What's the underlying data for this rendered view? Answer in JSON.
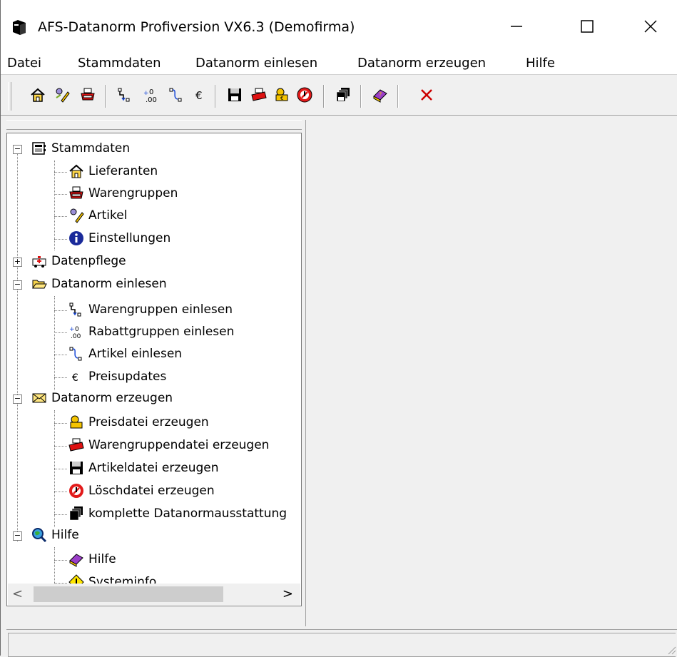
{
  "window": {
    "title": "AFS-Datanorm Profiversion VX6.3 (Demofirma)"
  },
  "menu": [
    "Datei",
    "Stammdaten",
    "Datanorm einlesen",
    "Datanorm erzeugen",
    "Hilfe"
  ],
  "toolbar": {
    "buttons": [
      "home-icon",
      "edit-icon",
      "printer-icon",
      "import-groups-icon",
      "import-discount-icon",
      "import-articles-icon",
      "euro-icon",
      "floppy-disk-icon",
      "printer-red-icon",
      "price-file-icon",
      "delete-file-icon",
      "complete-export-icon",
      "help-book-icon",
      "close-x-icon"
    ]
  },
  "tree": {
    "stammdaten": {
      "label": "Stammdaten",
      "children": [
        "Lieferanten",
        "Warengruppen",
        "Artikel",
        "Einstellungen"
      ]
    },
    "datenpflege": {
      "label": "Datenpflege"
    },
    "einlesen": {
      "label": "Datanorm einlesen",
      "children": [
        "Warengruppen einlesen",
        "Rabattgruppen einlesen",
        "Artikel einlesen",
        "Preisupdates"
      ]
    },
    "erzeugen": {
      "label": "Datanorm erzeugen",
      "children": [
        "Preisdatei erzeugen",
        "Warengruppendatei erzeugen",
        "Artikeldatei erzeugen",
        "Löschdatei erzeugen",
        "komplette Datanormausstattung"
      ]
    },
    "hilfe": {
      "label": "Hilfe",
      "children": [
        "Hilfe",
        "Systeminfo"
      ]
    }
  },
  "scroll": {
    "left_arrow": "<",
    "right_arrow": ">"
  },
  "colors": {
    "titlebar": "#ffffff",
    "panel": "#f0f0f0",
    "tree_bg": "#ffffff",
    "accent_red": "#cc0000"
  }
}
